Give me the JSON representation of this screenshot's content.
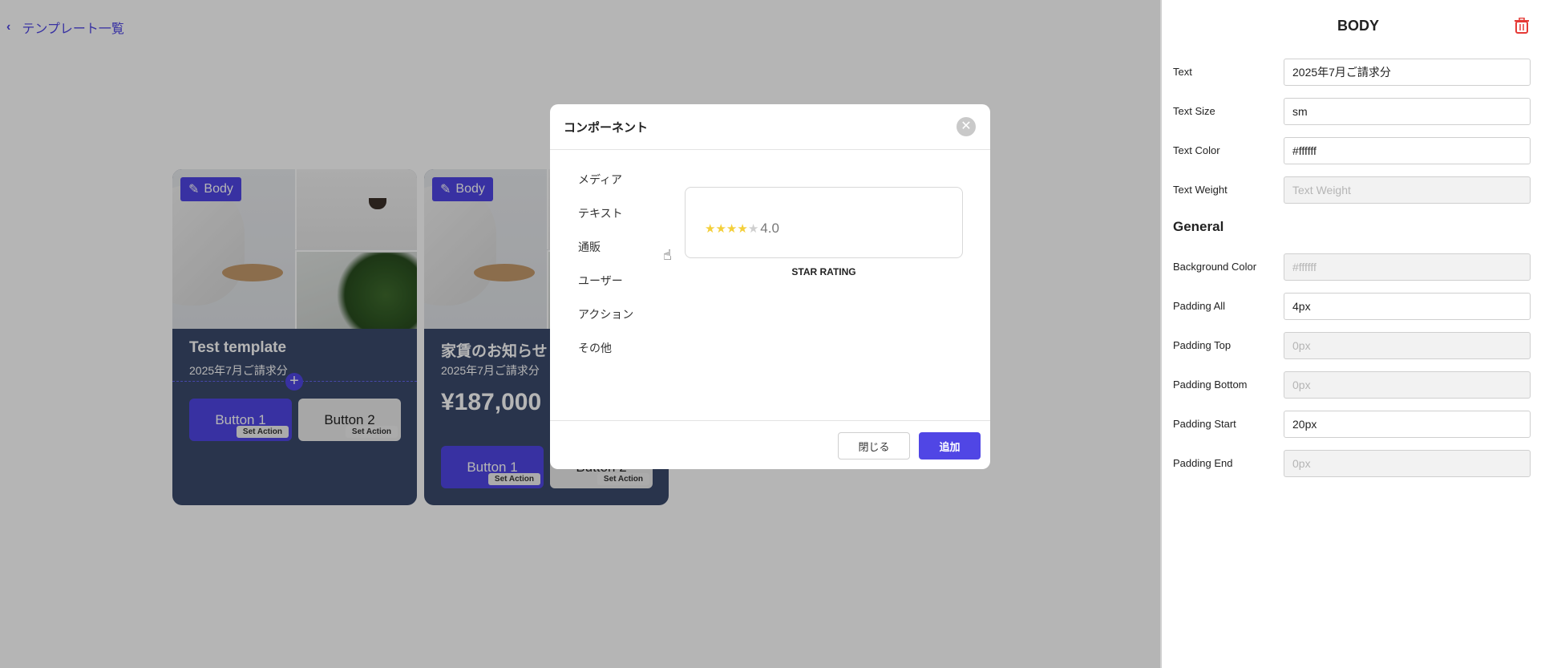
{
  "back_link": {
    "label": "テンプレート一覧"
  },
  "cards": [
    {
      "badge": "Body",
      "title": "Test template",
      "subtitle": "2025年7月ご請求分",
      "price": "",
      "buttons": [
        {
          "label": "Button 1",
          "action": "Set Action"
        },
        {
          "label": "Button 2",
          "action": "Set Action"
        }
      ]
    },
    {
      "badge": "Body",
      "title": "家賃のお知らせ",
      "subtitle": "2025年7月ご請求分",
      "price": "¥187,000",
      "buttons": [
        {
          "label": "Button 1",
          "action": "Set Action"
        },
        {
          "label": "Button 2",
          "action": "Set Action"
        }
      ]
    }
  ],
  "modal": {
    "title": "コンポーネント",
    "categories": [
      "メディア",
      "テキスト",
      "通販",
      "ユーザー",
      "アクション",
      "その他"
    ],
    "preview": {
      "rating_value": "4.0",
      "stars_filled": 4,
      "stars_total": 5,
      "label": "STAR RATING"
    },
    "close_button": "閉じる",
    "add_button": "追加"
  },
  "panel": {
    "title": "BODY",
    "fields": [
      {
        "label": "Text",
        "value": "2025年7月ご請求分",
        "placeholder": ""
      },
      {
        "label": "Text Size",
        "value": "sm",
        "placeholder": ""
      },
      {
        "label": "Text Color",
        "value": "#ffffff",
        "placeholder": ""
      },
      {
        "label": "Text Weight",
        "value": "",
        "placeholder": "Text Weight"
      }
    ],
    "general_title": "General",
    "general_fields": [
      {
        "label": "Background Color",
        "value": "",
        "placeholder": "#ffffff"
      },
      {
        "label": "Padding All",
        "value": "4px",
        "placeholder": ""
      },
      {
        "label": "Padding Top",
        "value": "",
        "placeholder": "0px"
      },
      {
        "label": "Padding Bottom",
        "value": "",
        "placeholder": "0px"
      },
      {
        "label": "Padding Start",
        "value": "20px",
        "placeholder": ""
      },
      {
        "label": "Padding End",
        "value": "",
        "placeholder": "0px"
      }
    ]
  },
  "colors": {
    "accent": "#5046e5",
    "card_bg": "#3b4a6b",
    "star": "#f4cf3a",
    "danger": "#e53935"
  }
}
